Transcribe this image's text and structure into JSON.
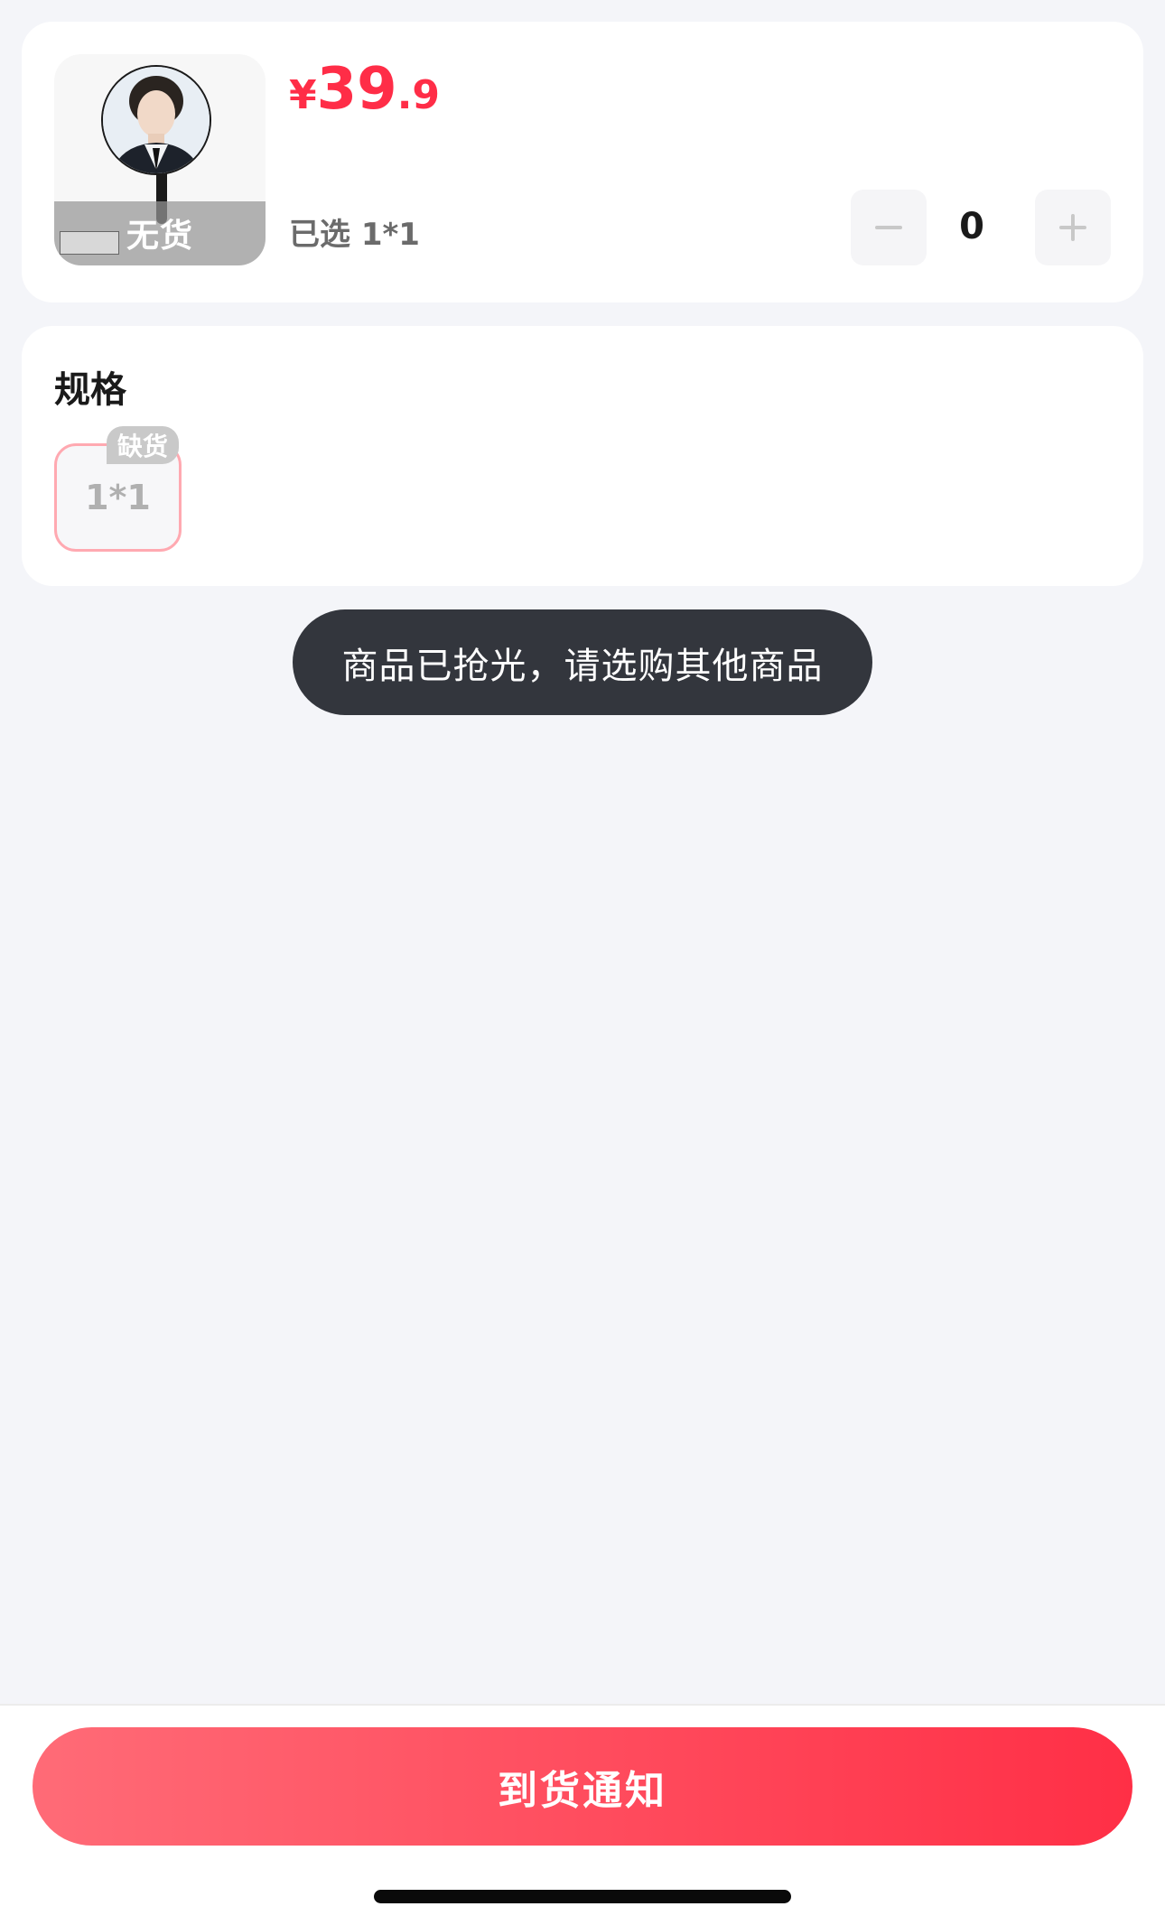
{
  "product": {
    "price_currency": "¥",
    "price_integer": "39",
    "price_decimal": ".9",
    "image_status": "无货",
    "selected_label": "已选 1*1",
    "quantity": "0",
    "image_icon": "photo-fan-icon"
  },
  "spec": {
    "title": "规格",
    "options": [
      {
        "label": "1*1",
        "badge": "缺货",
        "status": "out-of-stock"
      }
    ]
  },
  "toast": {
    "message": "商品已抢光，请选购其他商品"
  },
  "footer": {
    "notify_label": "到货通知"
  },
  "colors": {
    "accent": "#ff2d47",
    "button_gradient_start": "#ff6b77",
    "button_gradient_end": "#ff2f46",
    "toast_bg": "#33363d",
    "page_bg": "#f4f5f9"
  }
}
